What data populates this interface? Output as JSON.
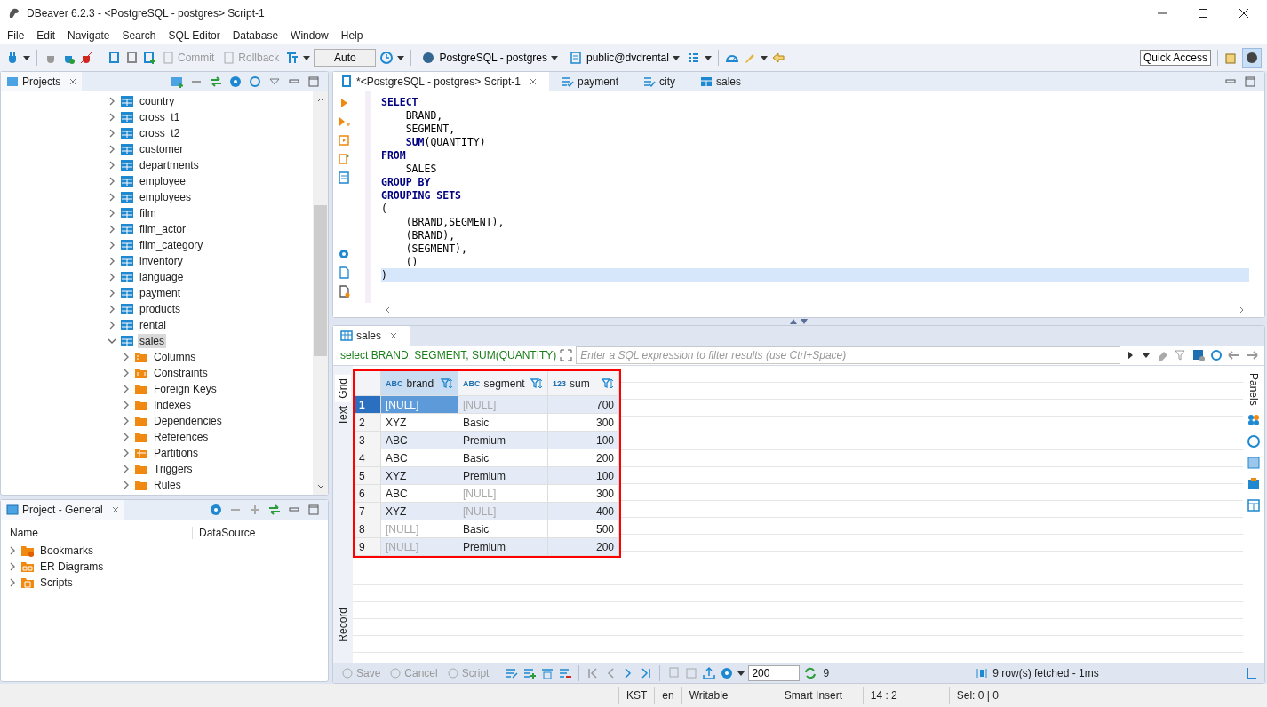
{
  "window": {
    "title": "DBeaver 6.2.3 - <PostgreSQL - postgres> Script-1"
  },
  "menu": [
    "File",
    "Edit",
    "Navigate",
    "Search",
    "SQL Editor",
    "Database",
    "Window",
    "Help"
  ],
  "toolbar": {
    "buttons": [
      {
        "label": "Commit",
        "disabled": true
      },
      {
        "label": "Rollback",
        "disabled": true
      }
    ],
    "mode": "Auto",
    "connection": "PostgreSQL - postgres",
    "schema": "public@dvdrental",
    "quick_access": "Quick Access"
  },
  "projects": {
    "title": "Projects",
    "tree": [
      {
        "label": "country",
        "kind": "table",
        "expanded": false,
        "selected": false
      },
      {
        "label": "cross_t1",
        "kind": "table",
        "expanded": false,
        "selected": false
      },
      {
        "label": "cross_t2",
        "kind": "table",
        "expanded": false,
        "selected": false
      },
      {
        "label": "customer",
        "kind": "table",
        "expanded": false,
        "selected": false
      },
      {
        "label": "departments",
        "kind": "table",
        "expanded": false,
        "selected": false
      },
      {
        "label": "employee",
        "kind": "table",
        "expanded": false,
        "selected": false
      },
      {
        "label": "employees",
        "kind": "table",
        "expanded": false,
        "selected": false
      },
      {
        "label": "film",
        "kind": "table",
        "expanded": false,
        "selected": false
      },
      {
        "label": "film_actor",
        "kind": "table",
        "expanded": false,
        "selected": false
      },
      {
        "label": "film_category",
        "kind": "table",
        "expanded": false,
        "selected": false
      },
      {
        "label": "inventory",
        "kind": "table",
        "expanded": false,
        "selected": false
      },
      {
        "label": "language",
        "kind": "table",
        "expanded": false,
        "selected": false
      },
      {
        "label": "payment",
        "kind": "table",
        "expanded": false,
        "selected": false
      },
      {
        "label": "products",
        "kind": "table",
        "expanded": false,
        "selected": false
      },
      {
        "label": "rental",
        "kind": "table",
        "expanded": false,
        "selected": false
      },
      {
        "label": "sales",
        "kind": "table",
        "expanded": true,
        "selected": true,
        "children": [
          {
            "label": "Columns",
            "kind": "columns",
            "expanded": false,
            "selected": false
          },
          {
            "label": "Constraints",
            "kind": "constraints",
            "expanded": false,
            "selected": false
          },
          {
            "label": "Foreign Keys",
            "kind": "folder",
            "expanded": false,
            "selected": false
          },
          {
            "label": "Indexes",
            "kind": "folder",
            "expanded": false,
            "selected": false
          },
          {
            "label": "Dependencies",
            "kind": "folder",
            "expanded": false,
            "selected": false
          },
          {
            "label": "References",
            "kind": "folder",
            "expanded": false,
            "selected": false
          },
          {
            "label": "Partitions",
            "kind": "partitions",
            "expanded": false,
            "selected": false
          },
          {
            "label": "Triggers",
            "kind": "folder",
            "expanded": false,
            "selected": false
          },
          {
            "label": "Rules",
            "kind": "folder",
            "expanded": false,
            "selected": false
          }
        ]
      }
    ]
  },
  "project_general": {
    "title": "Project - General",
    "columns": [
      "Name",
      "DataSource"
    ],
    "items": [
      {
        "label": "Bookmarks",
        "kind": "bookmarks"
      },
      {
        "label": "ER Diagrams",
        "kind": "diagrams"
      },
      {
        "label": "Scripts",
        "kind": "scripts"
      }
    ]
  },
  "editor": {
    "tabs": [
      {
        "label": "*<PostgreSQL - postgres> Script-1",
        "kind": "script",
        "selected": true
      },
      {
        "label": "payment",
        "kind": "view",
        "selected": false
      },
      {
        "label": "city",
        "kind": "view",
        "selected": false
      },
      {
        "label": "sales",
        "kind": "table",
        "selected": false
      }
    ],
    "lines": [
      {
        "text": "SELECT",
        "kind": "keyword",
        "current": false
      },
      {
        "text": "    BRAND,",
        "kind": "plain",
        "current": false
      },
      {
        "text": "    SEGMENT,",
        "kind": "plain",
        "current": false
      },
      {
        "text": "    **SUM**(QUANTITY)",
        "kind": "plain",
        "current": false
      },
      {
        "text": "FROM",
        "kind": "keyword",
        "current": false
      },
      {
        "text": "    SALES",
        "kind": "plain",
        "current": false
      },
      {
        "text": "GROUP BY",
        "kind": "keyword",
        "current": false
      },
      {
        "text": "GROUPING SETS",
        "kind": "keyword",
        "current": false
      },
      {
        "text": "(",
        "kind": "plain",
        "current": false
      },
      {
        "text": "    (BRAND,SEGMENT),",
        "kind": "plain",
        "current": false
      },
      {
        "text": "    (BRAND),",
        "kind": "plain",
        "current": false
      },
      {
        "text": "    (SEGMENT),",
        "kind": "plain",
        "current": false
      },
      {
        "text": "    ()",
        "kind": "plain",
        "current": false
      },
      {
        "text": ")",
        "kind": "plain",
        "current": true
      }
    ]
  },
  "results": {
    "tab": "sales",
    "query": "select BRAND, SEGMENT, SUM(QUANTITY)",
    "filter_placeholder": "Enter a SQL expression to filter results (use Ctrl+Space)",
    "side_tabs": [
      {
        "label": "Grid",
        "selected": true
      },
      {
        "label": "Text",
        "selected": false
      },
      {
        "label": "Record",
        "selected": false
      }
    ],
    "panels": "Panels",
    "highlighted": true,
    "columns": [
      {
        "type": "ABC",
        "name": "brand"
      },
      {
        "type": "ABC",
        "name": "segment"
      },
      {
        "type": "123",
        "name": "sum"
      }
    ],
    "rows": [
      {
        "number": "1",
        "selected": true,
        "cells": [
          {
            "text": "[NULL]",
            "null": true
          },
          {
            "text": "[NULL]",
            "null": true
          },
          {
            "text": "700",
            "null": false
          }
        ]
      },
      {
        "number": "2",
        "selected": false,
        "cells": [
          {
            "text": "XYZ",
            "null": false
          },
          {
            "text": "Basic",
            "null": false
          },
          {
            "text": "300",
            "null": false
          }
        ]
      },
      {
        "number": "3",
        "selected": false,
        "cells": [
          {
            "text": "ABC",
            "null": false
          },
          {
            "text": "Premium",
            "null": false
          },
          {
            "text": "100",
            "null": false
          }
        ]
      },
      {
        "number": "4",
        "selected": false,
        "cells": [
          {
            "text": "ABC",
            "null": false
          },
          {
            "text": "Basic",
            "null": false
          },
          {
            "text": "200",
            "null": false
          }
        ]
      },
      {
        "number": "5",
        "selected": false,
        "cells": [
          {
            "text": "XYZ",
            "null": false
          },
          {
            "text": "Premium",
            "null": false
          },
          {
            "text": "100",
            "null": false
          }
        ]
      },
      {
        "number": "6",
        "selected": false,
        "cells": [
          {
            "text": "ABC",
            "null": false
          },
          {
            "text": "[NULL]",
            "null": true
          },
          {
            "text": "300",
            "null": false
          }
        ]
      },
      {
        "number": "7",
        "selected": false,
        "cells": [
          {
            "text": "XYZ",
            "null": false
          },
          {
            "text": "[NULL]",
            "null": true
          },
          {
            "text": "400",
            "null": false
          }
        ]
      },
      {
        "number": "8",
        "selected": false,
        "cells": [
          {
            "text": "[NULL]",
            "null": true
          },
          {
            "text": "Basic",
            "null": false
          },
          {
            "text": "500",
            "null": false
          }
        ]
      },
      {
        "number": "9",
        "selected": false,
        "cells": [
          {
            "text": "[NULL]",
            "null": true
          },
          {
            "text": "Premium",
            "null": false
          },
          {
            "text": "200",
            "null": false
          }
        ]
      }
    ],
    "footer_buttons": [
      {
        "label": "Save",
        "disabled": true
      },
      {
        "label": "Cancel",
        "disabled": true
      },
      {
        "label": "Script",
        "disabled": true
      }
    ],
    "fetch_size": "200",
    "refresh_count": "9",
    "status": "9 row(s) fetched - 1ms"
  },
  "status_bar": [
    "KST",
    "en",
    "Writable",
    "Smart Insert",
    "14 : 2",
    "Sel: 0 | 0"
  ]
}
